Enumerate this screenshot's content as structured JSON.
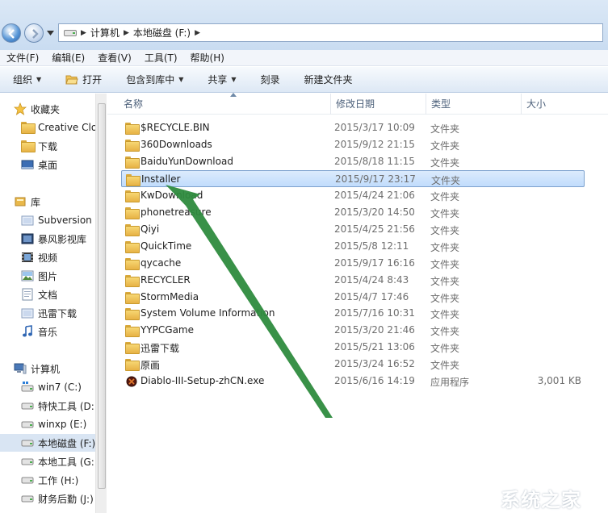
{
  "address": {
    "crumbs": [
      "计算机",
      "本地磁盘 (F:)"
    ]
  },
  "menu": [
    "文件(F)",
    "编辑(E)",
    "查看(V)",
    "工具(T)",
    "帮助(H)"
  ],
  "toolbar": {
    "organize": "组织",
    "open": "打开",
    "include_library": "包含到库中",
    "share": "共享",
    "burn": "刻录",
    "new_folder": "新建文件夹"
  },
  "nav": {
    "favorites": "收藏夹",
    "fav_items": [
      "Creative Clo",
      "下载",
      "桌面"
    ],
    "libraries": "库",
    "lib_items": [
      "Subversion",
      "暴风影视库",
      "视频",
      "图片",
      "文档",
      "迅雷下载",
      "音乐"
    ],
    "computer": "计算机",
    "drives": [
      "win7 (C:)",
      "特快工具 (D:",
      "winxp (E:)",
      "本地磁盘 (F:)",
      "本地工具 (G:",
      "工作 (H:)",
      "财务后勤 (J:)"
    ]
  },
  "columns": {
    "name": "名称",
    "date": "修改日期",
    "type": "类型",
    "size": "大小"
  },
  "files": [
    {
      "name": "$RECYCLE.BIN",
      "date": "2015/3/17 10:09",
      "type": "文件夹",
      "size": ""
    },
    {
      "name": "360Downloads",
      "date": "2015/9/12 21:15",
      "type": "文件夹",
      "size": ""
    },
    {
      "name": "BaiduYunDownload",
      "date": "2015/8/18 11:15",
      "type": "文件夹",
      "size": ""
    },
    {
      "name": "Installer",
      "date": "2015/9/17 23:17",
      "type": "文件夹",
      "size": ""
    },
    {
      "name": "KwDownload",
      "date": "2015/4/24 21:06",
      "type": "文件夹",
      "size": ""
    },
    {
      "name": "phonetreasure",
      "date": "2015/3/20 14:50",
      "type": "文件夹",
      "size": ""
    },
    {
      "name": "Qiyi",
      "date": "2015/4/25 21:56",
      "type": "文件夹",
      "size": ""
    },
    {
      "name": "QuickTime",
      "date": "2015/5/8 12:11",
      "type": "文件夹",
      "size": ""
    },
    {
      "name": "qycache",
      "date": "2015/9/17 16:16",
      "type": "文件夹",
      "size": ""
    },
    {
      "name": "RECYCLER",
      "date": "2015/4/24 8:43",
      "type": "文件夹",
      "size": ""
    },
    {
      "name": "StormMedia",
      "date": "2015/4/7 17:46",
      "type": "文件夹",
      "size": ""
    },
    {
      "name": "System Volume Information",
      "date": "2015/7/16 10:31",
      "type": "文件夹",
      "size": ""
    },
    {
      "name": "YYPCGame",
      "date": "2015/3/20 21:46",
      "type": "文件夹",
      "size": ""
    },
    {
      "name": "迅雷下载",
      "date": "2015/5/21 13:06",
      "type": "文件夹",
      "size": ""
    },
    {
      "name": "原画",
      "date": "2015/3/24 16:52",
      "type": "文件夹",
      "size": ""
    },
    {
      "name": "Diablo-III-Setup-zhCN.exe",
      "date": "2015/6/16 14:19",
      "type": "应用程序",
      "size": "3,001 KB"
    }
  ],
  "watermark": {
    "text": "系统之家"
  },
  "colors": {
    "selection": "#c1dcfc",
    "arrow": "#2e8b3e"
  }
}
